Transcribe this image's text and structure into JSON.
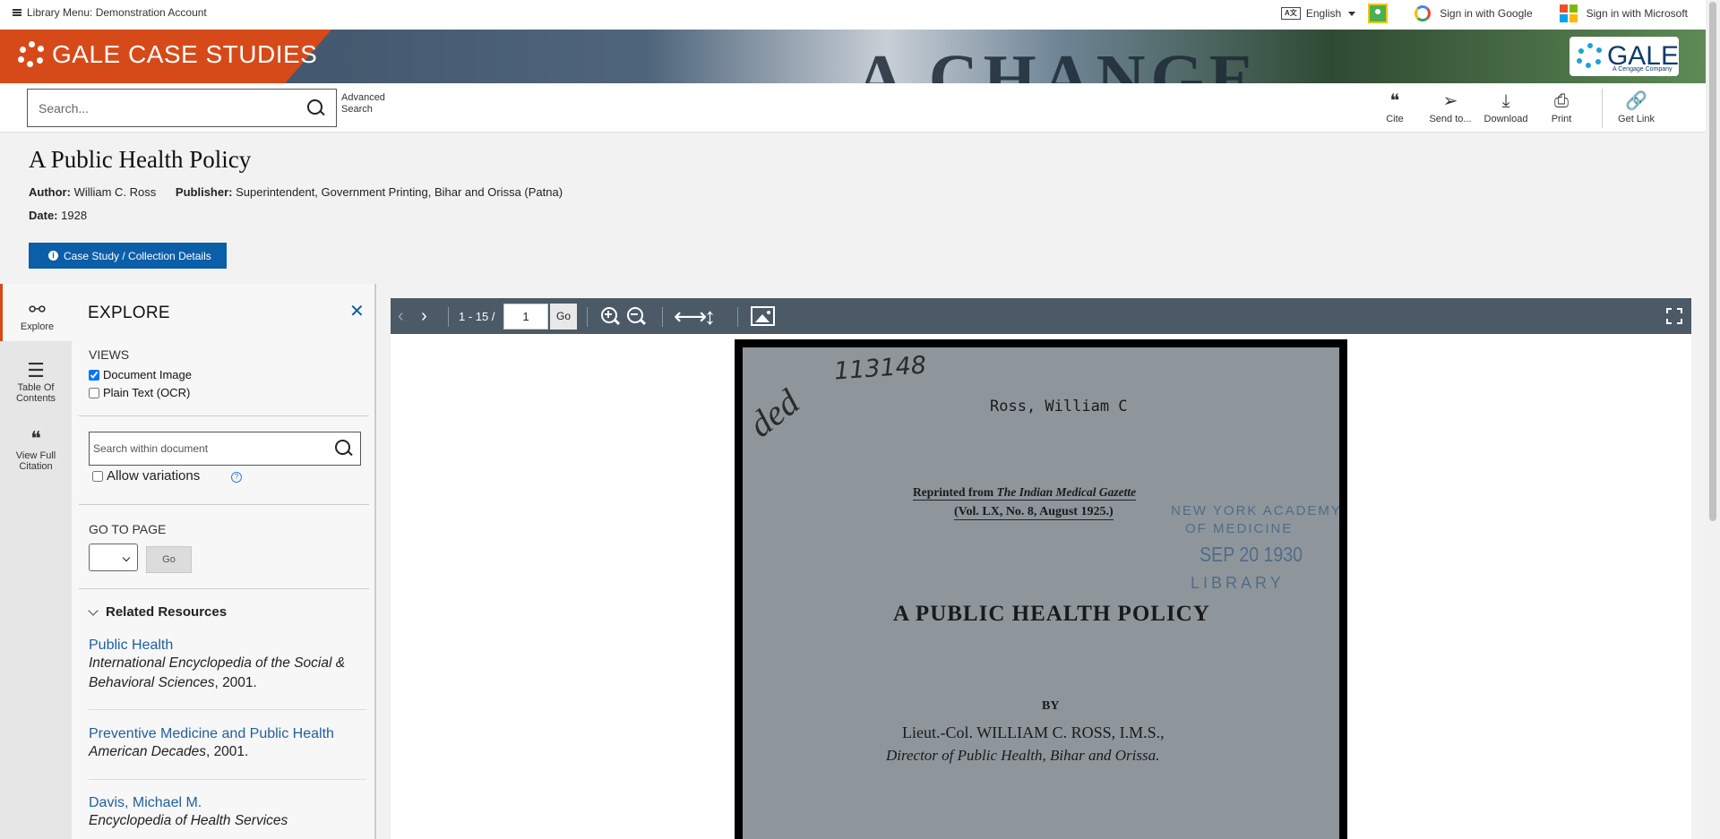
{
  "topbar": {
    "library_menu": "Library Menu: Demonstration Account",
    "language": "English",
    "sign_in_google": "Sign in with Google",
    "sign_in_microsoft": "Sign in with Microsoft"
  },
  "banner": {
    "brand": "GALE CASE STUDIES",
    "background_text": "A CHANGE",
    "logo_word": "GALE",
    "logo_sub": "A Cengage Company"
  },
  "search": {
    "placeholder": "Search...",
    "advanced_line1": "Advanced",
    "advanced_line2": "Search"
  },
  "tools": [
    {
      "label": "Cite",
      "icon": "quote-icon"
    },
    {
      "label": "Send to...",
      "icon": "send-icon"
    },
    {
      "label": "Download",
      "icon": "download-icon"
    },
    {
      "label": "Print",
      "icon": "print-icon"
    },
    {
      "label": "Get Link",
      "icon": "link-icon"
    }
  ],
  "document": {
    "title": "A Public Health Policy",
    "author_label": "Author:",
    "author": "William C. Ross",
    "publisher_label": "Publisher:",
    "publisher": "Superintendent, Government Printing, Bihar and Orissa (Patna)",
    "date_label": "Date:",
    "date": "1928",
    "details_button": "Case Study / Collection Details"
  },
  "rail": [
    {
      "label_1": "Explore",
      "label_2": "",
      "icon": "binoculars-icon"
    },
    {
      "label_1": "Table Of",
      "label_2": "Contents",
      "icon": "list-icon"
    },
    {
      "label_1": "View Full",
      "label_2": "Citation",
      "icon": "quote-icon"
    }
  ],
  "explore": {
    "heading": "EXPLORE",
    "views_label": "VIEWS",
    "view_document_image": "Document Image",
    "view_plain_text": "Plain Text (OCR)",
    "search_placeholder": "Search within document",
    "allow_variations": "Allow variations",
    "go_to_page": "GO TO PAGE",
    "go": "Go",
    "related_heading": "Related Resources",
    "related": [
      {
        "title": "Public Health",
        "source": "International Encyclopedia of the Social & Behavioral Sciences",
        "year": ", 2001."
      },
      {
        "title": "Preventive Medicine and Public Health",
        "source": "American Decades",
        "year": ", 2001."
      },
      {
        "title": "Davis, Michael M.",
        "source": "Encyclopedia of Health Services",
        "year": ""
      }
    ]
  },
  "viewer": {
    "page_range": "1 - 15 /",
    "page_value": "1",
    "go": "Go"
  },
  "page_image": {
    "handwritten_number": "113148",
    "handwritten_note": "ded",
    "author_line": "Ross, William C",
    "reprint_line_1_prefix": "Reprinted from ",
    "reprint_line_1_journal": "The Indian Medical Gazette",
    "reprint_line_2": "(Vol. LX, No. 8, August 1925.)",
    "stamp_line_1": "NEW YORK ACADEMY",
    "stamp_line_2": "OF MEDICINE",
    "stamp_line_3": "SEP 20 1930",
    "stamp_line_4": "LIBRARY",
    "heading": "A PUBLIC HEALTH POLICY",
    "by": "BY",
    "byline": "Lieut.-Col. WILLIAM C. ROSS, I.M.S.,",
    "position": "Director of Public Health, Bihar and Orissa."
  },
  "colors": {
    "brand_orange": "#d64a19",
    "primary_blue": "#0b5ea8",
    "link_blue": "#1f5f9e",
    "viewer_toolbar": "#4b5a66"
  }
}
